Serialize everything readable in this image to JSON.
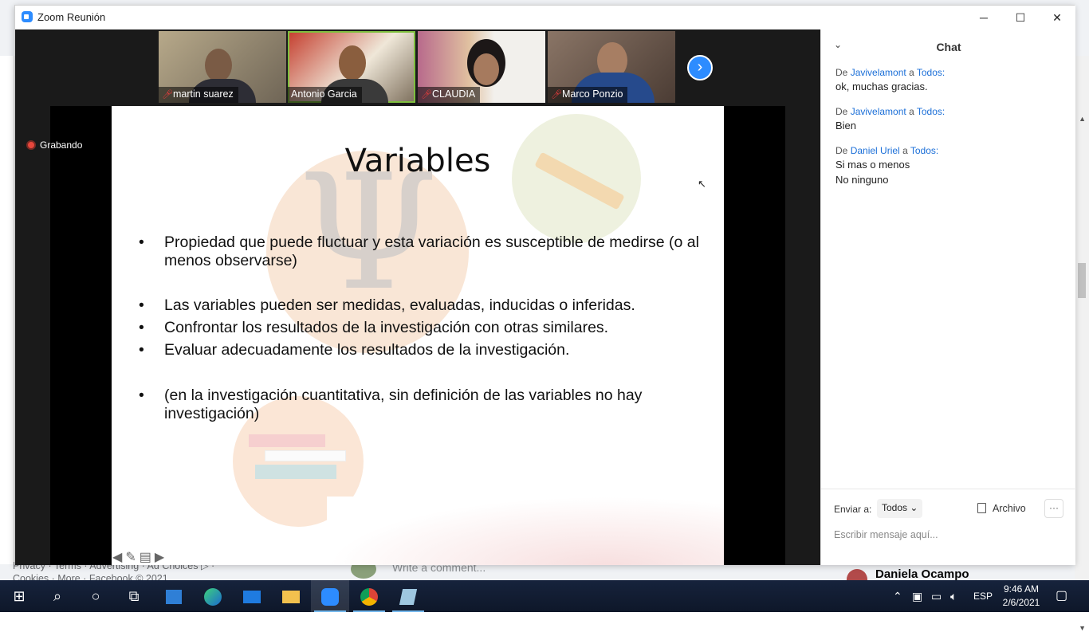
{
  "window": {
    "title": "Zoom Reunión",
    "controls": {
      "minimize": "─",
      "maximize": "☐",
      "close": "✕"
    }
  },
  "participants": [
    {
      "name": "martin suarez",
      "muted": true
    },
    {
      "name": "Antonio Garcia",
      "muted": false,
      "active": true
    },
    {
      "name": "CLAUDIA",
      "muted": true
    },
    {
      "name": "Marco Ponzio",
      "muted": true
    }
  ],
  "recording_label": "Grabando",
  "slide": {
    "title": "Variables",
    "bullets": [
      "Propiedad que puede fluctuar y esta variación es susceptible de medirse (o al menos observarse)",
      "Las variables pueden ser medidas, evaluadas, inducidas o inferidas.",
      "Confrontar los resultados de la investigación con otras similares.",
      "Evaluar adecuadamente los resultados de la investigación.",
      "(en la investigación cuantitativa, sin definición de las variables no hay investigación)"
    ]
  },
  "chat": {
    "title": "Chat",
    "messages": [
      {
        "prefix": "De",
        "from": "Javivelamont",
        "sep": "a",
        "to": "Todos:",
        "lines": [
          "ok, muchas gracias."
        ]
      },
      {
        "prefix": "De",
        "from": "Javivelamont",
        "sep": "a",
        "to": "Todos:",
        "lines": [
          "Bien"
        ]
      },
      {
        "prefix": "De",
        "from": "Daniel Uriel",
        "sep": "a",
        "to": "Todos:",
        "lines": [
          "Si mas o menos",
          "No ninguno"
        ]
      }
    ],
    "send_to_label": "Enviar a:",
    "send_to_value": "Todos",
    "file_label": "Archivo",
    "more_label": "···",
    "input_placeholder": "Escribir mensaje aquí..."
  },
  "background": {
    "footer_line1": "Privacy · Terms · Advertising · Ad Choices ▷ ·",
    "footer_line2": "Cookies · More · Facebook © 2021",
    "comment_placeholder": "Write a comment...",
    "profile_name": "Daniela Ocampo"
  },
  "taskbar": {
    "language": "ESP",
    "time": "9:46 AM",
    "date": "2/6/2021"
  }
}
